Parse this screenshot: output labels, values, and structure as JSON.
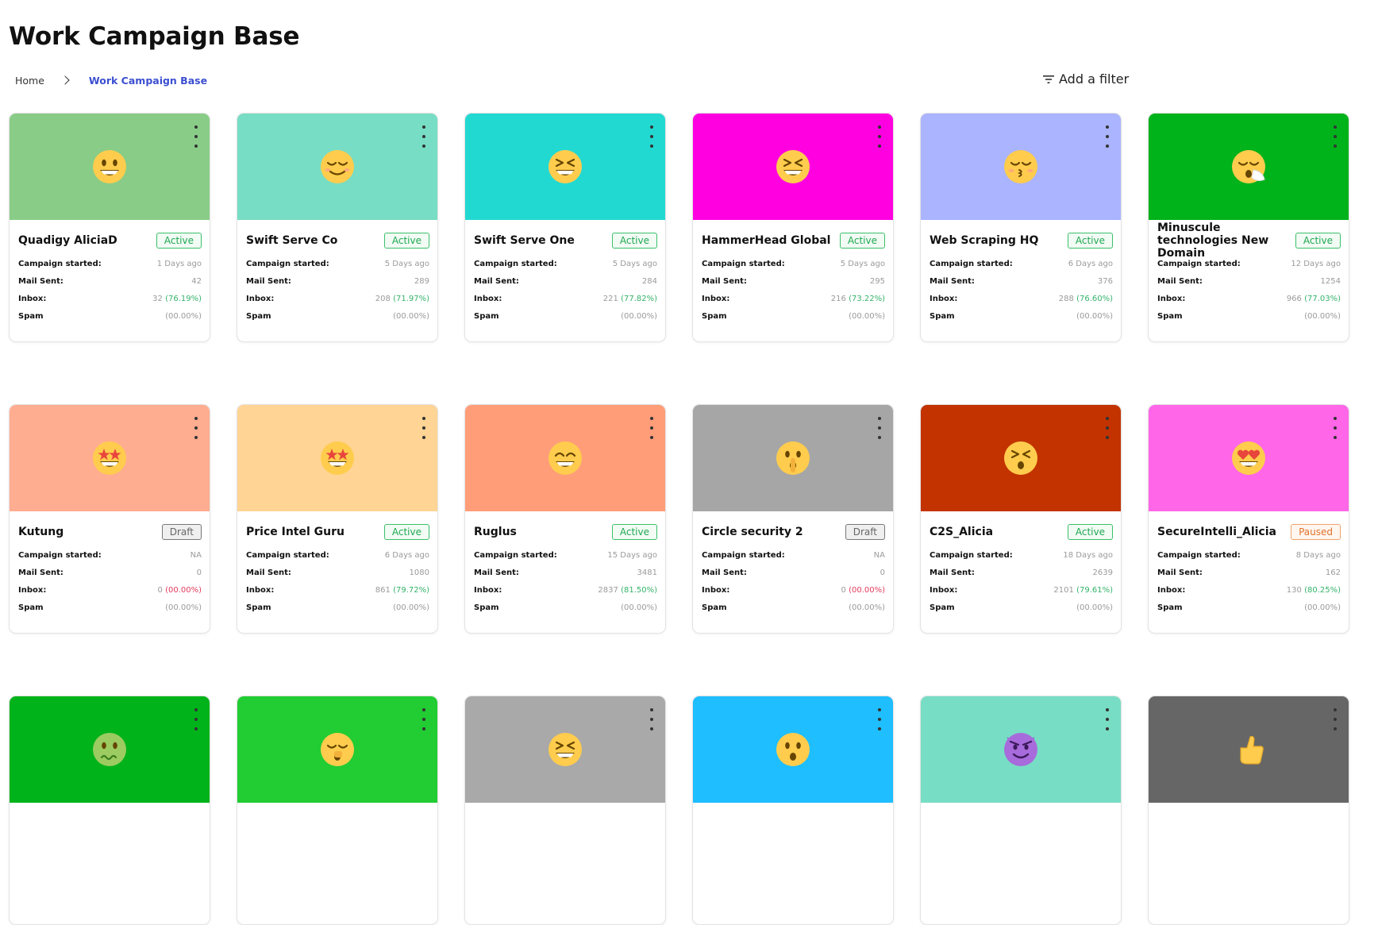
{
  "page": {
    "title": "Work Campaign Base"
  },
  "breadcrumb": {
    "home": "Home",
    "current": "Work Campaign Base"
  },
  "filter": {
    "label": "Add a filter",
    "icon": "filter-icon"
  },
  "labels": {
    "started": "Campaign started:",
    "mail": "Mail Sent:",
    "inbox": "Inbox:",
    "spam": "Spam"
  },
  "cards": [
    {
      "name": "Quadigy AliciaD",
      "status": "Active",
      "status_type": "active",
      "color": "#88cc88",
      "emoji": "grinning-face",
      "started": "1 Days ago",
      "mail": "42",
      "inbox": "32",
      "inbox_pct": "(76.19%)",
      "inbox_pct_color": "green",
      "spam_pct": "(00.00%)"
    },
    {
      "name": "Swift Serve Co",
      "status": "Active",
      "status_type": "active",
      "color": "#77ddc4",
      "emoji": "relieved-face",
      "started": "5 Days ago",
      "mail": "289",
      "inbox": "208",
      "inbox_pct": "(71.97%)",
      "inbox_pct_color": "green",
      "spam_pct": "(00.00%)"
    },
    {
      "name": "Swift Serve One",
      "status": "Active",
      "status_type": "active",
      "color": "#22d9d2",
      "emoji": "squinting-face",
      "started": "5 Days ago",
      "mail": "284",
      "inbox": "221",
      "inbox_pct": "(77.82%)",
      "inbox_pct_color": "green",
      "spam_pct": "(00.00%)"
    },
    {
      "name": "HammerHead Global",
      "status": "Active",
      "status_type": "active",
      "color": "#ff00e1",
      "emoji": "squinting-face",
      "started": "5 Days ago",
      "mail": "295",
      "inbox": "216",
      "inbox_pct": "(73.22%)",
      "inbox_pct_color": "green",
      "spam_pct": "(00.00%)"
    },
    {
      "name": "Web Scraping HQ",
      "status": "Active",
      "status_type": "active",
      "color": "#aab4ff",
      "emoji": "kissing-face",
      "started": "6 Days ago",
      "mail": "376",
      "inbox": "288",
      "inbox_pct": "(76.60%)",
      "inbox_pct_color": "green",
      "spam_pct": "(00.00%)"
    },
    {
      "name": "Minuscule technologies New Domain",
      "status": "Active",
      "status_type": "active",
      "color": "#00b31a",
      "emoji": "sneezing-face",
      "started": "12 Days ago",
      "mail": "1254",
      "inbox": "966",
      "inbox_pct": "(77.03%)",
      "inbox_pct_color": "green",
      "spam_pct": "(00.00%)"
    },
    {
      "name": "Kutung",
      "status": "Draft",
      "status_type": "draft",
      "color": "#ffad90",
      "emoji": "star-struck",
      "started": "NA",
      "mail": "0",
      "inbox": "0",
      "inbox_pct": "(00.00%)",
      "inbox_pct_color": "red",
      "spam_pct": "(00.00%)"
    },
    {
      "name": "Price Intel Guru",
      "status": "Active",
      "status_type": "active",
      "color": "#ffd494",
      "emoji": "star-struck",
      "started": "6 Days ago",
      "mail": "1080",
      "inbox": "861",
      "inbox_pct": "(79.72%)",
      "inbox_pct_color": "green",
      "spam_pct": "(00.00%)"
    },
    {
      "name": "Ruglus",
      "status": "Active",
      "status_type": "active",
      "color": "#ff9d79",
      "emoji": "beaming-face",
      "started": "15 Days ago",
      "mail": "3481",
      "inbox": "2837",
      "inbox_pct": "(81.50%)",
      "inbox_pct_color": "green",
      "spam_pct": "(00.00%)"
    },
    {
      "name": "Circle security 2",
      "status": "Draft",
      "status_type": "draft",
      "color": "#a6a6a6",
      "emoji": "shushing-face",
      "started": "NA",
      "mail": "0",
      "inbox": "0",
      "inbox_pct": "(00.00%)",
      "inbox_pct_color": "red",
      "spam_pct": "(00.00%)"
    },
    {
      "name": "C2S_Alicia",
      "status": "Active",
      "status_type": "active",
      "color": "#c23300",
      "emoji": "tired-face",
      "started": "18 Days ago",
      "mail": "2639",
      "inbox": "2101",
      "inbox_pct": "(79.61%)",
      "inbox_pct_color": "green",
      "spam_pct": "(00.00%)"
    },
    {
      "name": "SecureIntelli_Alicia",
      "status": "Paused",
      "status_type": "paused",
      "color": "#ff66e8",
      "emoji": "heart-eyes",
      "started": "8 Days ago",
      "mail": "162",
      "inbox": "130",
      "inbox_pct": "(80.25%)",
      "inbox_pct_color": "green",
      "spam_pct": "(00.00%)"
    },
    {
      "name": "",
      "status": "",
      "status_type": "",
      "color": "#00b31a",
      "emoji": "nauseated-face"
    },
    {
      "name": "",
      "status": "",
      "status_type": "",
      "color": "#22cc33",
      "emoji": "yawning-face"
    },
    {
      "name": "",
      "status": "",
      "status_type": "",
      "color": "#a9a9a9",
      "emoji": "squinting-face"
    },
    {
      "name": "",
      "status": "",
      "status_type": "",
      "color": "#1ebeff",
      "emoji": "hushed-face"
    },
    {
      "name": "",
      "status": "",
      "status_type": "",
      "color": "#77ddc4",
      "emoji": "smiling-devil"
    },
    {
      "name": "",
      "status": "",
      "status_type": "",
      "color": "#666666",
      "emoji": "thumbs-up"
    }
  ]
}
